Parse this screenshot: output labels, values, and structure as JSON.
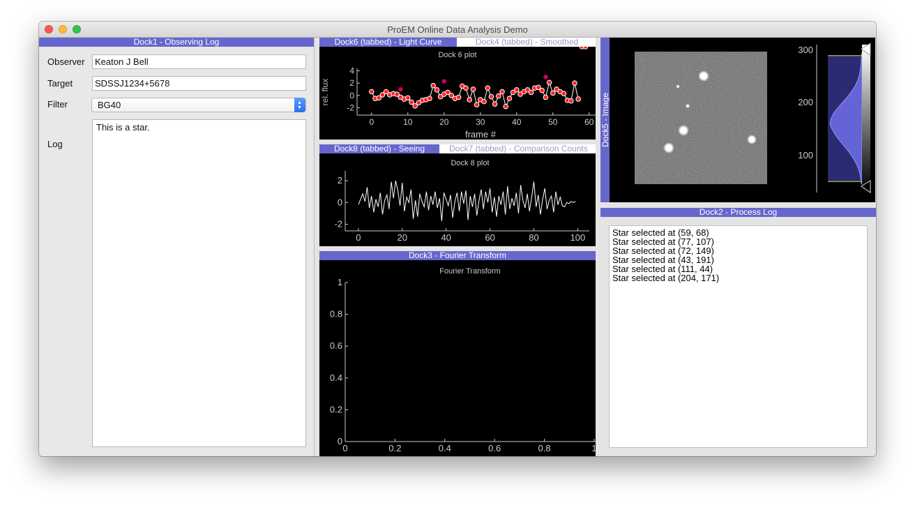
{
  "window": {
    "title": "ProEM Online Data Analysis Demo"
  },
  "dock1": {
    "header": "Dock1 - Observing Log",
    "observer_label": "Observer",
    "observer_value": "Keaton J Bell",
    "target_label": "Target",
    "target_value": "SDSSJ1234+5678",
    "filter_label": "Filter",
    "filter_value": "BG40",
    "log_label": "Log",
    "log_value": "This is a star."
  },
  "dock6": {
    "tab_active": "Dock6 (tabbed) - Light Curve",
    "tab_inactive": "Dock4 (tabbed) - Smoothed",
    "plot_title": "Dock 6 plot",
    "xlabel": "frame #",
    "ylabel": "rel. flux"
  },
  "dock8": {
    "tab_active": "Dock8 (tabbed) - Seeing",
    "tab_inactive": "Dock7 (tabbed) - Comparison Counts",
    "plot_title": "Dock 8 plot"
  },
  "dock3": {
    "header": "Dock3 - Fourier Transform",
    "plot_title": "Fourier Transform"
  },
  "dock5": {
    "header": "Dock5 - Image"
  },
  "dock2": {
    "header": "Dock2 - Process Log",
    "lines": [
      "Star selected at (59, 68)",
      "Star selected at (77, 107)",
      "Star selected at (72, 149)",
      "Star selected at (43, 191)",
      "Star selected at (111, 44)",
      "Star selected at (204, 171)"
    ]
  },
  "colors": {
    "dock_header": "#6666cc",
    "inactive_tab_text": "#9999cc",
    "light_curve_point": "#ff2222",
    "highlight_point": "#cc0066",
    "histogram_fill": "#6464d6"
  },
  "chart_data": [
    {
      "type": "scatter",
      "name": "light-curve",
      "title": "Dock 6 plot",
      "xlabel": "frame #",
      "ylabel": "rel. flux",
      "xlim": [
        -4,
        61
      ],
      "ylim": [
        -3.2,
        4.4
      ],
      "xticks": [
        0,
        10,
        20,
        30,
        40,
        50,
        60
      ],
      "yticks": [
        -2,
        0,
        2,
        4
      ],
      "x": [
        0,
        1,
        2,
        3,
        4,
        5,
        6,
        7,
        8,
        9,
        10,
        11,
        12,
        13,
        14,
        15,
        16,
        17,
        18,
        19,
        20,
        21,
        22,
        23,
        24,
        25,
        26,
        27,
        28,
        29,
        30,
        31,
        32,
        33,
        34,
        35,
        36,
        37,
        38,
        39,
        40,
        41,
        42,
        43,
        44,
        45,
        46,
        47,
        48,
        49,
        50,
        51,
        52,
        53,
        54,
        55,
        56,
        57,
        58,
        59
      ],
      "y": [
        0.6,
        -0.5,
        -0.4,
        0.1,
        0.6,
        0.1,
        0.3,
        0.2,
        -0.3,
        -0.6,
        -0.4,
        -1.1,
        -1.7,
        -1.2,
        -0.8,
        -0.7,
        -0.5,
        1.6,
        0.9,
        -0.2,
        0.2,
        0.5,
        0.0,
        -0.5,
        -0.3,
        1.5,
        1.2,
        -0.7,
        1.0,
        -1.5,
        -0.7,
        -1.0,
        1.2,
        -0.2,
        -1.4,
        -0.1,
        0.6,
        -1.8,
        -0.5,
        0.5,
        0.9,
        0.2,
        0.6,
        0.9,
        0.5,
        1.2,
        1.3,
        0.8,
        -0.3,
        2.1,
        0.4,
        1.0,
        0.6,
        0.3,
        -0.8,
        -0.9,
        2.0,
        -0.6
      ],
      "highlights": [
        {
          "x": 8,
          "y": 1.0
        },
        {
          "x": 20,
          "y": 2.3
        },
        {
          "x": 48,
          "y": 3.0
        }
      ]
    },
    {
      "type": "line",
      "name": "seeing",
      "title": "Dock 8 plot",
      "xlim": [
        -6,
        104
      ],
      "ylim": [
        -2.6,
        2.9
      ],
      "xticks": [
        0,
        20,
        40,
        60,
        80,
        100
      ],
      "yticks": [
        -2,
        0,
        2
      ],
      "x": [
        0,
        1,
        2,
        3,
        4,
        5,
        6,
        7,
        8,
        9,
        10,
        11,
        12,
        13,
        14,
        15,
        16,
        17,
        18,
        19,
        20,
        21,
        22,
        23,
        24,
        25,
        26,
        27,
        28,
        29,
        30,
        31,
        32,
        33,
        34,
        35,
        36,
        37,
        38,
        39,
        40,
        41,
        42,
        43,
        44,
        45,
        46,
        47,
        48,
        49,
        50,
        51,
        52,
        53,
        54,
        55,
        56,
        57,
        58,
        59,
        60,
        61,
        62,
        63,
        64,
        65,
        66,
        67,
        68,
        69,
        70,
        71,
        72,
        73,
        74,
        75,
        76,
        77,
        78,
        79,
        80,
        81,
        82,
        83,
        84,
        85,
        86,
        87,
        88,
        89,
        90,
        91,
        92,
        93,
        94,
        95,
        96,
        97,
        98,
        99
      ],
      "y": [
        -0.2,
        0.3,
        0.8,
        0.1,
        1.4,
        -0.5,
        0.6,
        -0.9,
        0.3,
        -0.4,
        0.9,
        -1.1,
        0.2,
        0.7,
        -0.6,
        1.9,
        0.4,
        2.0,
        1.1,
        -0.3,
        1.8,
        -0.8,
        0.5,
        0.0,
        1.2,
        -1.5,
        0.2,
        -1.3,
        0.8,
        0.1,
        -0.4,
        1.0,
        -0.7,
        0.6,
        -0.2,
        1.0,
        -0.5,
        0.4,
        -1.7,
        0.9,
        0.3,
        -0.3,
        0.7,
        -1.4,
        0.1,
        0.9,
        -0.8,
        1.0,
        -0.1,
        1.1,
        -1.6,
        0.6,
        -0.4,
        0.8,
        -1.2,
        0.2,
        1.2,
        -0.6,
        1.0,
        0.0,
        1.3,
        -0.9,
        0.5,
        -1.3,
        0.6,
        -0.2,
        1.0,
        -1.1,
        1.5,
        -0.6,
        0.4,
        -0.3,
        0.9,
        -1.0,
        1.6,
        0.2,
        -0.5,
        0.8,
        -0.8,
        0.5,
        1.9,
        -0.4,
        0.7,
        -1.1,
        0.3,
        1.3,
        -0.6,
        0.2,
        0.6,
        -0.9,
        1.0,
        -0.2,
        0.5,
        -0.3,
        -0.4,
        0.0,
        -0.1,
        0.1,
        0.0,
        0.1
      ]
    },
    {
      "type": "line",
      "name": "fourier-transform",
      "title": "Fourier Transform",
      "xlim": [
        0,
        1
      ],
      "ylim": [
        0,
        1
      ],
      "xticks": [
        0,
        0.2,
        0.4,
        0.6,
        0.8,
        1
      ],
      "yticks": [
        0,
        0.2,
        0.4,
        0.6,
        0.8,
        1
      ],
      "x": [],
      "y": []
    },
    {
      "type": "area",
      "name": "image-histogram",
      "yticks": [
        100,
        200,
        300
      ],
      "ylim": [
        50,
        320
      ],
      "levels": [
        70,
        300
      ],
      "bins": [
        65,
        75,
        85,
        95,
        105,
        115,
        125,
        135,
        145,
        155,
        165,
        175,
        185,
        195,
        205,
        215,
        225,
        235,
        245,
        255,
        265,
        275,
        285,
        295,
        305
      ],
      "counts": [
        0.02,
        0.04,
        0.07,
        0.12,
        0.2,
        0.3,
        0.42,
        0.56,
        0.7,
        0.83,
        0.93,
        1.0,
        0.97,
        0.88,
        0.75,
        0.6,
        0.45,
        0.32,
        0.21,
        0.13,
        0.08,
        0.05,
        0.03,
        0.02,
        0.01
      ]
    }
  ]
}
